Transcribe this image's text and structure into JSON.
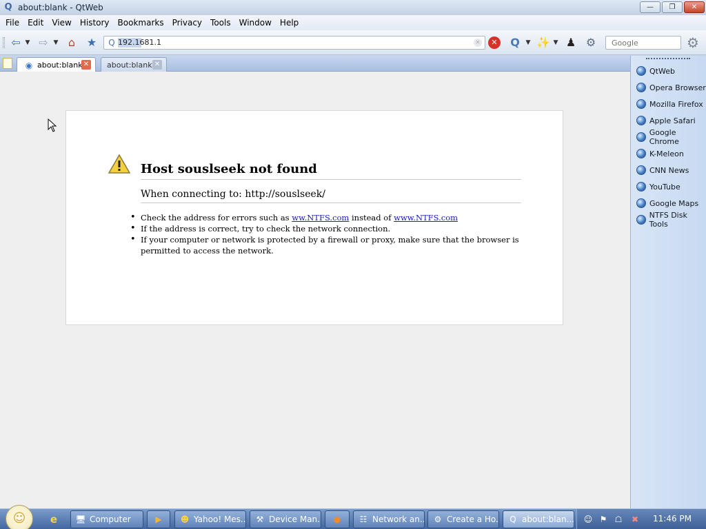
{
  "window": {
    "title": "about:blank - QtWeb",
    "minimize": "—",
    "maximize": "❐",
    "close": "✕"
  },
  "menu": [
    "File",
    "Edit",
    "View",
    "History",
    "Bookmarks",
    "Privacy",
    "Tools",
    "Window",
    "Help"
  ],
  "toolbar": {
    "address_value": "192.1681.1",
    "search_placeholder": "Google"
  },
  "tabs": [
    {
      "label": "about:blank",
      "active": true
    },
    {
      "label": "about:blank",
      "active": false
    }
  ],
  "error": {
    "title": "Host souslseek not found",
    "subtitle": "When connecting to: http://souslseek/",
    "bullet1_prefix": "Check the address for errors such as ",
    "bullet1_link1": "ww.NTFS.com",
    "bullet1_mid": " instead of ",
    "bullet1_link2": "www.NTFS.com",
    "bullet2": "If the address is correct, try to check the network connection.",
    "bullet3": "If your computer or network is protected by a firewall or proxy, make sure that the browser is permitted to access the network."
  },
  "sidebar": {
    "items": [
      "QtWeb",
      "Opera Browser",
      "Mozilla Firefox",
      "Apple Safari",
      "Google Chrome",
      "K-Meleon",
      "CNN News",
      "YouTube",
      "Google Maps",
      "NTFS Disk Tools"
    ]
  },
  "taskbar": {
    "tasks": [
      "Computer",
      "Yahoo! Mes...",
      "Device Man...",
      "Network an...",
      "Create a Ho...",
      "about:blan..."
    ],
    "clock": "11:46 PM"
  }
}
